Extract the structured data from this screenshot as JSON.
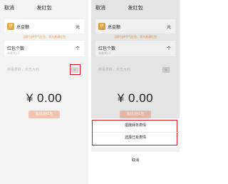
{
  "left": {
    "nav": {
      "cancel": "取消",
      "title": "发红包"
    },
    "total": {
      "badge": "拼",
      "label": "总金额",
      "unit": "元"
    },
    "count": {
      "label": "红包个数",
      "unit": "个",
      "hint": "本群共2人"
    },
    "hint_top": "当前为拼手气红包，改为普通红包",
    "blessing_placeholder": "恭喜发财，大吉大利",
    "cover_icon": "emoji-cover-icon",
    "amount": "¥ 0.00",
    "send_button": "塞钱进红包"
  },
  "right": {
    "nav": {
      "cancel": "取消",
      "title": "发红包"
    },
    "total": {
      "badge": "拼",
      "label": "总金额",
      "unit": "元"
    },
    "count": {
      "label": "红包个数",
      "unit": "个",
      "hint": "本群共2人"
    },
    "hint_top": "当前为拼手气红包，改为普通红包",
    "blessing_placeholder": "恭喜发财，大吉大利",
    "cover_icon": "emoji-cover-icon",
    "amount": "¥ 0.00",
    "send_button": "塞钱进红包",
    "sheet": {
      "option1": "拍摄拜年表情",
      "option2": "选择已有表情",
      "cancel": "取消"
    }
  }
}
